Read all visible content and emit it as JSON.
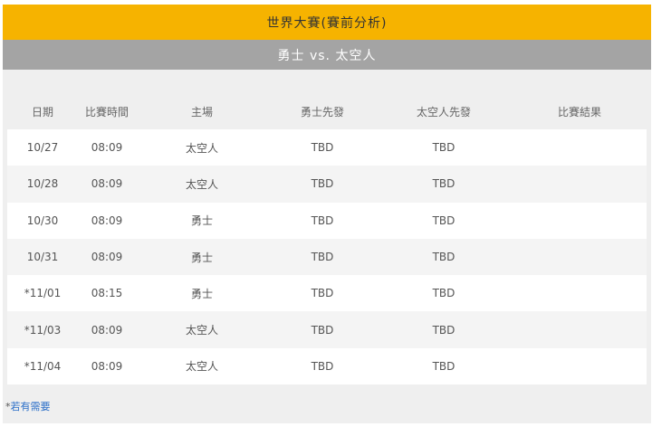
{
  "header": {
    "title": "世界大賽(賽前分析)",
    "matchup": "勇士 vs. 太空人"
  },
  "table": {
    "columns": [
      "日期",
      "比賽時間",
      "主場",
      "勇士先發",
      "太空人先發",
      "比賽結果"
    ],
    "rows": [
      [
        "10/27",
        "08:09",
        "太空人",
        "TBD",
        "TBD",
        ""
      ],
      [
        "10/28",
        "08:09",
        "太空人",
        "TBD",
        "TBD",
        ""
      ],
      [
        "10/30",
        "08:09",
        "勇士",
        "TBD",
        "TBD",
        ""
      ],
      [
        "10/31",
        "08:09",
        "勇士",
        "TBD",
        "TBD",
        ""
      ],
      [
        "*11/01",
        "08:15",
        "勇士",
        "TBD",
        "TBD",
        ""
      ],
      [
        "*11/03",
        "08:09",
        "太空人",
        "TBD",
        "TBD",
        ""
      ],
      [
        "*11/04",
        "08:09",
        "太空人",
        "TBD",
        "TBD",
        ""
      ]
    ]
  },
  "footnote": {
    "prefix": "*",
    "link_text": "若有需要"
  }
}
